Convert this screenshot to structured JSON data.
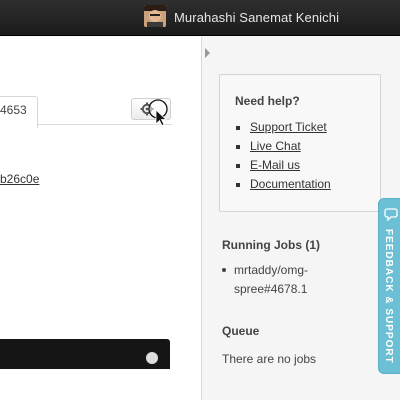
{
  "user": {
    "name": "Murahashi Sanemat Kenichi"
  },
  "main": {
    "tab_label": "4653",
    "commit_link": "b26c0e"
  },
  "help": {
    "title": "Need help?",
    "links": [
      "Support Ticket",
      "Live Chat",
      "E-Mail us",
      "Documentation"
    ]
  },
  "running_jobs": {
    "title": "Running Jobs (1)",
    "items": [
      "mrtaddy/omg-spree#4678.1"
    ]
  },
  "queue": {
    "title": "Queue",
    "empty_text": "There are no jobs"
  },
  "feedback": {
    "label": "FEEDBACK & SUPPORT"
  },
  "icons": {
    "settings": "gear-icon",
    "cursor": "mouse-pointer-icon",
    "feedback": "chat-bubble-icon",
    "collapse": "chevron-right-icon"
  },
  "colors": {
    "topbar": "#1f1f1f",
    "feedback_tab": "#6cc0d6"
  }
}
